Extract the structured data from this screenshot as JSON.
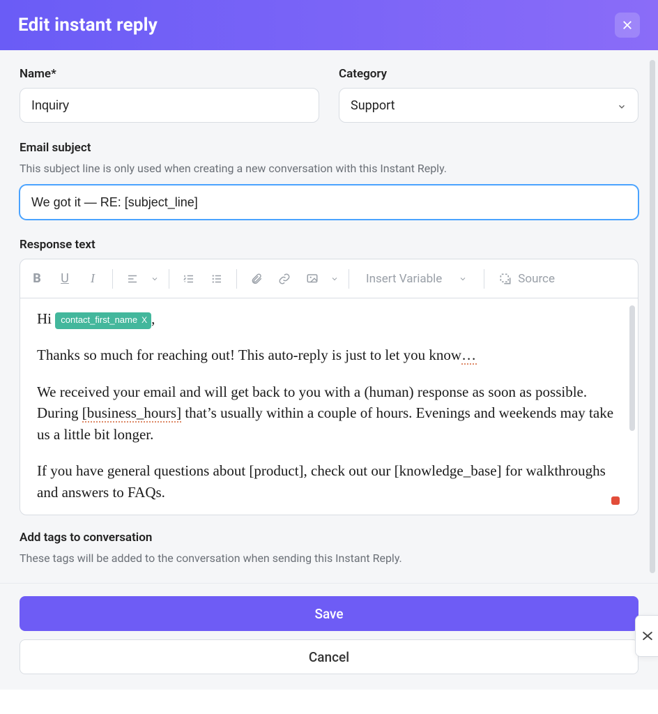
{
  "header": {
    "title": "Edit instant reply"
  },
  "fields": {
    "name_label": "Name*",
    "name_value": "Inquiry",
    "category_label": "Category",
    "category_value": "Support",
    "subject_label": "Email subject",
    "subject_helper": "This subject line is only used when creating a new conversation with this Instant Reply.",
    "subject_value": "We got it — RE: [subject_line]",
    "response_label": "Response text",
    "tags_label": "Add tags to conversation",
    "tags_helper": "These tags will be added to the conversation when sending this Instant Reply."
  },
  "toolbar": {
    "insert_variable": "Insert Variable",
    "source": "Source"
  },
  "editor": {
    "greeting_prefix": "Hi ",
    "variable_chip": "contact_first_name",
    "greeting_suffix": ",",
    "p1_a": "Thanks so much for reaching out! This auto-reply is just to let you know",
    "p1_dots": "…",
    "p2_a": "We received your email and will get back to you with a (human) response as soon as possible. During ",
    "p2_var": "[business_hours]",
    "p2_b": " that’s usually within a couple of hours. Evenings and weekends may take us a little bit longer.",
    "p3": "If you have general questions about [product], check out our [knowledge_base] for walkthroughs and answers to FAQs."
  },
  "buttons": {
    "save": "Save",
    "cancel": "Cancel"
  },
  "icons": {
    "close": "close-icon",
    "chevron_down": "chevron-down-icon",
    "bold": "bold-icon",
    "underline": "underline-icon",
    "italic": "italic-icon",
    "align": "align-icon",
    "ol": "ordered-list-icon",
    "ul": "unordered-list-icon",
    "attach": "attachment-icon",
    "link": "link-icon",
    "image": "image-icon",
    "source": "source-icon"
  },
  "colors": {
    "accent": "#6e5cf5",
    "chip": "#43b79c"
  }
}
